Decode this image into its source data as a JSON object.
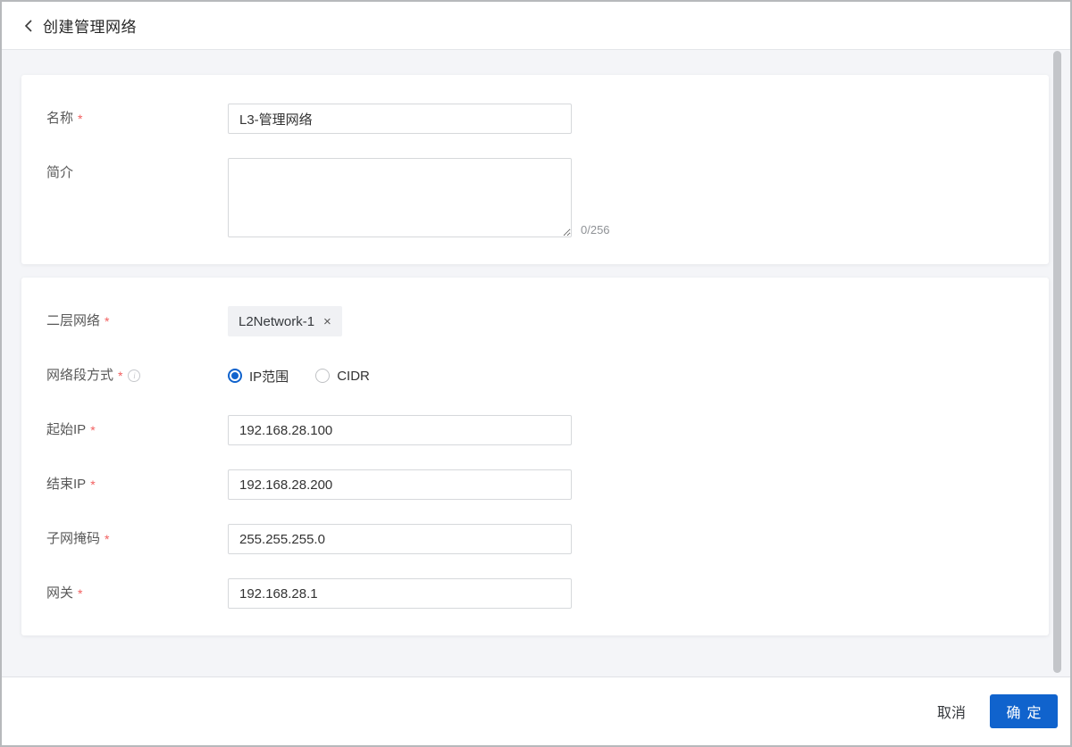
{
  "header": {
    "title": "创建管理网络"
  },
  "icons": {
    "back": "‹",
    "remove_tag": "×",
    "info": "i"
  },
  "form": {
    "basic": {
      "name": {
        "label": "名称",
        "required": "*",
        "value": "L3-管理网络"
      },
      "description": {
        "label": "简介",
        "value": "",
        "counter": "0/256"
      }
    },
    "network": {
      "l2network": {
        "label": "二层网络",
        "required": "*",
        "tag": "L2Network-1"
      },
      "segment_mode": {
        "label": "网络段方式",
        "required": "*",
        "options": [
          {
            "label": "IP范围",
            "selected": true
          },
          {
            "label": "CIDR",
            "selected": false
          }
        ]
      },
      "start_ip": {
        "label": "起始IP",
        "required": "*",
        "value": "192.168.28.100"
      },
      "end_ip": {
        "label": "结束IP",
        "required": "*",
        "value": "192.168.28.200"
      },
      "netmask": {
        "label": "子网掩码",
        "required": "*",
        "value": "255.255.255.0"
      },
      "gateway": {
        "label": "网关",
        "required": "*",
        "value": "192.168.28.1"
      }
    }
  },
  "footer": {
    "cancel_label": "取消",
    "confirm_label": "确定"
  },
  "colors": {
    "primary": "#1063cd",
    "required": "#f25f5f",
    "page_bg": "#f4f5f8"
  }
}
